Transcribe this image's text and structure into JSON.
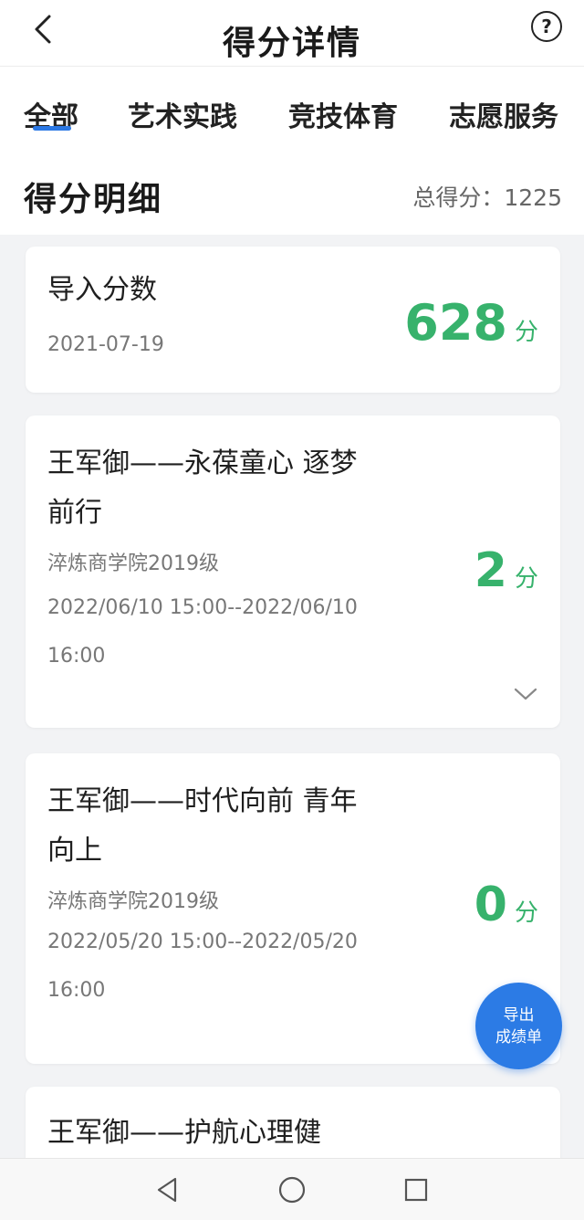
{
  "header": {
    "title": "得分详情",
    "back_icon": "chevron-left-icon",
    "help_icon": "question-circle-icon",
    "help_glyph": "?"
  },
  "tabs": [
    {
      "label": "全部",
      "active": true
    },
    {
      "label": "艺术实践",
      "active": false
    },
    {
      "label": "竞技体育",
      "active": false
    },
    {
      "label": "志愿服务",
      "active": false
    }
  ],
  "section": {
    "title": "得分明细",
    "total_label": "总得分：",
    "total_value": "1225"
  },
  "records": [
    {
      "title": "导入分数",
      "date": "2021-07-19",
      "score": "628",
      "unit": "分"
    },
    {
      "title": "王军御——永葆童心 逐梦前行",
      "org": "淬炼商学院2019级",
      "time": "2022/06/10 15:00--2022/06/10 16:00",
      "score": "2",
      "unit": "分"
    },
    {
      "title": "王军御——时代向前 青年向上",
      "org": "淬炼商学院2019级",
      "time": "2022/05/20 15:00--2022/05/20 16:00",
      "score": "0",
      "unit": "分"
    },
    {
      "title": "王军御——护航心理健"
    }
  ],
  "fab": {
    "line1": "导出",
    "line2": "成绩单"
  },
  "accent": "#2b78e4",
  "score_color": "#37b26c"
}
